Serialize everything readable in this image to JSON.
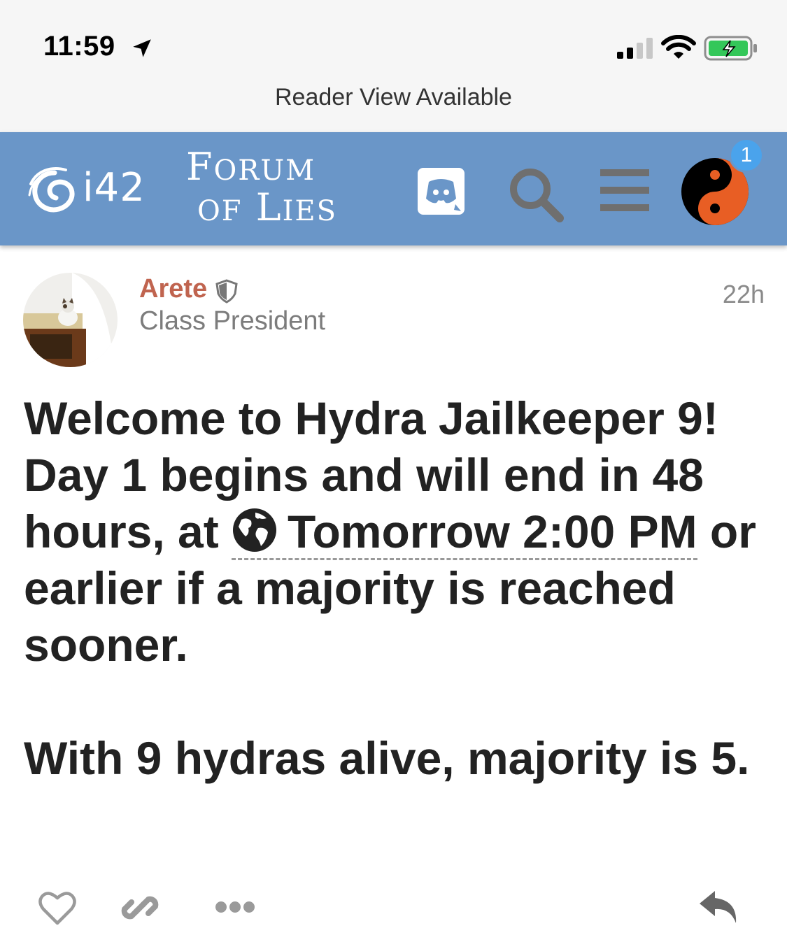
{
  "status_bar": {
    "time": "11:59",
    "icons": [
      "location-arrow-icon",
      "cellular-signal-icon",
      "wifi-icon",
      "battery-charging-icon"
    ]
  },
  "browser": {
    "reader_view_label": "Reader View Available"
  },
  "header": {
    "logo_text": "i42",
    "title_line1": {
      "cap": "F",
      "rest": "ORUM"
    },
    "title_line2": {
      "first": "OF",
      "cap": "L",
      "rest": "IES"
    },
    "icons": [
      "discord-icon",
      "search-icon",
      "hamburger-menu-icon",
      "user-avatar-yin-yang"
    ],
    "notification_count": "1",
    "colors": {
      "header_bg": "#6a96c8",
      "badge": "#4aa3ec",
      "avatar_orange": "#e85e24"
    }
  },
  "post": {
    "username": "Arete",
    "user_title": "Class President",
    "age": "22h",
    "paragraph1": {
      "before_date": "Welcome to Hydra Jailkeeper 9! Day 1 begins and will end in 48 hours, at ",
      "date_label": "Tomorrow 2:00 PM",
      "after_date": " or earlier if a majority is reached sooner."
    },
    "paragraph2": "With 9 hydras alive, majority is 5.",
    "colors": {
      "username": "#c0644f",
      "body": "#222222"
    }
  },
  "actions": [
    "heart-icon",
    "link-icon",
    "more-dots-icon",
    "reply-icon"
  ]
}
